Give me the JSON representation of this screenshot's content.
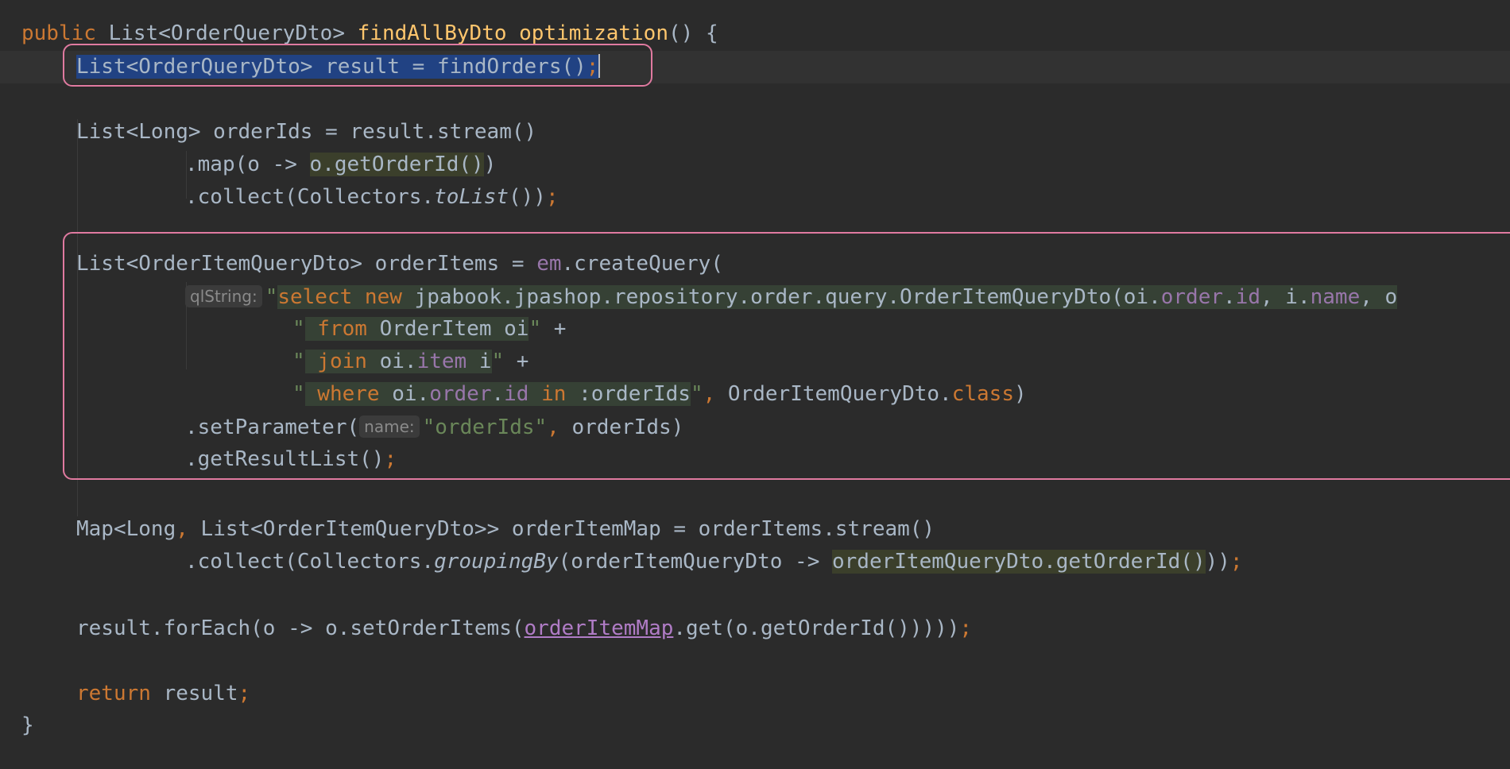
{
  "code": {
    "l1": {
      "public": "public",
      "list_type": " List<OrderQueryDto> ",
      "method_name": "findAllByDto_optimization",
      "tail": "() {"
    },
    "l2": {
      "selected_stmt": "List<OrderQueryDto> result = findOrders()",
      "semi": ";",
      "cursor_char": ""
    },
    "l4": {
      "text": "List<Long> orderIds = result.stream()"
    },
    "l5": {
      "pre": ".map(o -> ",
      "match": "o.getOrderId()",
      "post": ")"
    },
    "l6": {
      "pre": ".collect(Collectors.",
      "ital": "toList",
      "post": "())",
      "semi": ";"
    },
    "l8": {
      "pre": "List<OrderItemQueryDto> orderItems = ",
      "em": "em",
      "post": ".createQuery("
    },
    "l9": {
      "hint": "qlString:",
      "q": "\"",
      "select": "select",
      "new": " new",
      "path": " jpabook.jpashop.repository.order.query.OrderItemQueryDto(oi.",
      "order": "order",
      "dot1": ".",
      "id": "id",
      "comma1": ", i.",
      "name": "name",
      "tail": ", o"
    },
    "l10": {
      "q1": "\"",
      "from": " from",
      "rest": " OrderItem oi",
      "q2": "\"",
      "plus": " +"
    },
    "l11": {
      "q1": "\"",
      "join": " join",
      "oi": " oi.",
      "item": "item",
      "i": " i",
      "q2": "\"",
      "plus": " +"
    },
    "l12": {
      "q1": "\"",
      "where": " where",
      "oi": " oi.",
      "order": "order",
      "dot": ".",
      "id": "id",
      "in": " in",
      "param": " :orderIds",
      "q2": "\"",
      "comma": ",",
      "cls": " OrderItemQueryDto.",
      "class_kw": "class",
      "close": ")"
    },
    "l13": {
      "pre": ".setParameter(",
      "hint": "name:",
      "str": "\"orderIds\"",
      "comma": ",",
      "post": " orderIds)"
    },
    "l14": {
      "pre": ".getResultList()",
      "semi": ";"
    },
    "l16": {
      "pre": "Map<Long",
      "comma": ",",
      "post": " List<OrderItemQueryDto>> orderItemMap = orderItems.stream()"
    },
    "l17": {
      "pre": ".collect(Collectors.",
      "ital": "groupingBy",
      "mid": "(orderItemQueryDto -> ",
      "match": "orderItemQueryDto.getOrderId()",
      "post": "))",
      "semi": ";"
    },
    "l19": {
      "pre": "result.forEach(o -> o.setOrderItems(",
      "field": "orderItemMap",
      "post": ".get(o.getOrderId()))))",
      "semi": ";"
    },
    "l21": {
      "kw": "return",
      "post": " result",
      "semi": ";"
    },
    "l22": {
      "text": "}"
    }
  },
  "colors": {
    "background": "#2b2b2b",
    "keyword": "#cc7832",
    "function": "#ffc66d",
    "field": "#9876aa",
    "string": "#6a8759",
    "text": "#a9b7c6",
    "selection": "#214283",
    "highlight_box": "#e07aa0"
  }
}
